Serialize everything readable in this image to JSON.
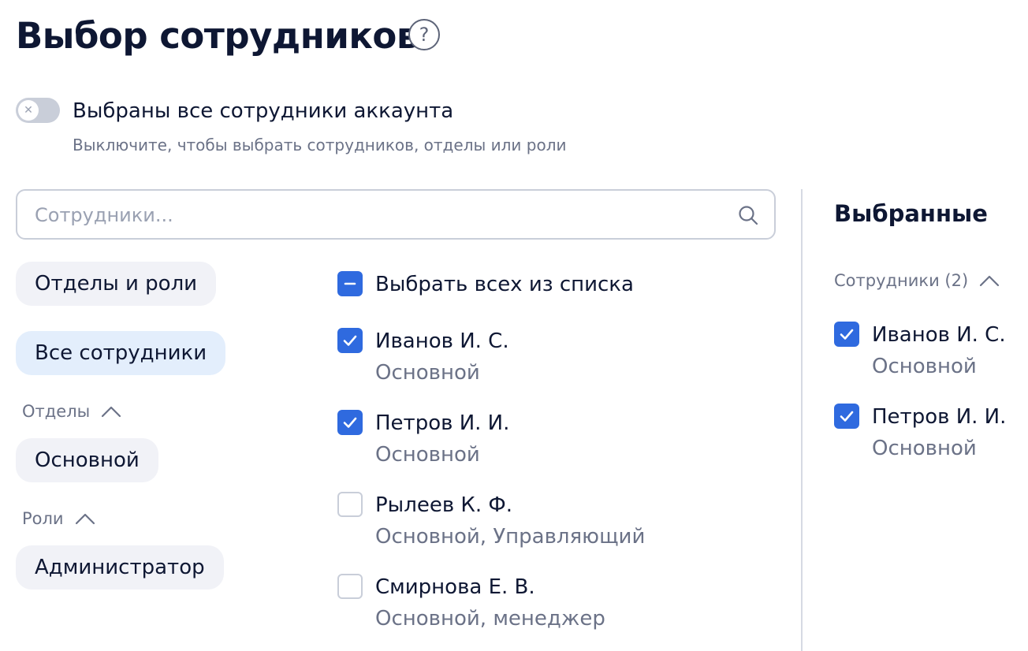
{
  "page": {
    "title": "Выбор сотрудников",
    "help_icon": "question-mark-icon",
    "help_symbol": "?"
  },
  "toggle": {
    "label": "Выбраны все сотрудники аккаунта",
    "hint": "Выключите, чтобы выбрать сотрудников, отделы или роли",
    "state": "off",
    "knob_symbol": "✕"
  },
  "search": {
    "placeholder": "Сотрудники...",
    "value": "",
    "icon": "search-icon"
  },
  "filters": {
    "departments_roles": "Отделы и роли",
    "all_employees": "Все сотрудники",
    "departments_header": "Отделы",
    "departments": [
      "Основной"
    ],
    "roles_header": "Роли",
    "roles": [
      "Администратор"
    ]
  },
  "list": {
    "select_all_label": "Выбрать всех из списка",
    "select_all_state": "indeterminate",
    "employees": [
      {
        "name": "Иванов И. С.",
        "details": "Основной",
        "checked": true
      },
      {
        "name": "Петров И. И.",
        "details": "Основной",
        "checked": true
      },
      {
        "name": "Рылеев К. Ф.",
        "details": "Основной, Управляющий",
        "checked": false
      },
      {
        "name": "Смирнова Е. В.",
        "details": "Основной, менеджер",
        "checked": false
      }
    ]
  },
  "selected": {
    "title": "Выбранные",
    "group_header": "Сотрудники (2)",
    "items": [
      {
        "name": "Иванов И. С.",
        "details": "Основной",
        "checked": true
      },
      {
        "name": "Петров И. И.",
        "details": "Основной",
        "checked": true
      }
    ]
  },
  "colors": {
    "accent": "#2f6adf",
    "text": "#0e1733",
    "muted": "#6b7287",
    "chip": "#f1f2f7",
    "chip_active": "#e3eefc"
  }
}
